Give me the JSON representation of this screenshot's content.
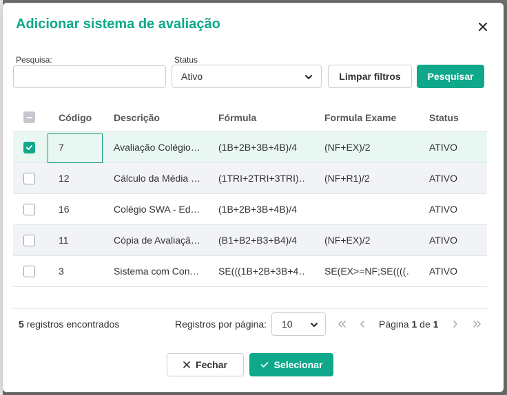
{
  "modal": {
    "title": "Adicionar sistema de avaliação"
  },
  "filters": {
    "search_label": "Pesquisa:",
    "search_value": "",
    "status_label": "Status",
    "status_value": "Ativo",
    "clear_label": "Limpar filtros",
    "search_button_label": "Pesquisar"
  },
  "table": {
    "headers": {
      "code": "Código",
      "description": "Descrição",
      "formula": "Fórmula",
      "exam_formula": "Formula Exame",
      "status": "Status"
    },
    "rows": [
      {
        "code": "7",
        "description": "Avaliação Colégio…",
        "formula": "(1B+2B+3B+4B)/4",
        "exam_formula": "(NF+EX)/2",
        "status": "ATIVO",
        "checked": true
      },
      {
        "code": "12",
        "description": "Cálculo da Média …",
        "formula": "(1TRI+2TRI+3TRI)…",
        "exam_formula": "(NF+R1)/2",
        "status": "ATIVO",
        "checked": false
      },
      {
        "code": "16",
        "description": "Colégio SWA - Ed…",
        "formula": "(1B+2B+3B+4B)/4",
        "exam_formula": "",
        "status": "ATIVO",
        "checked": false
      },
      {
        "code": "11",
        "description": "Cópia de Avaliaçã…",
        "formula": "(B1+B2+B3+B4)/4",
        "exam_formula": "(NF+EX)/2",
        "status": "ATIVO",
        "checked": false
      },
      {
        "code": "3",
        "description": "Sistema com Con…",
        "formula": "SE(((1B+2B+3B+4…",
        "exam_formula": "SE(EX>=NF;SE((((…",
        "status": "ATIVO",
        "checked": false
      }
    ]
  },
  "footer": {
    "count": "5",
    "count_suffix": " registros encontrados",
    "per_page_label": "Registros por página:",
    "per_page_value": "10",
    "page_prefix": "Página ",
    "page_current": "1",
    "page_of": " de ",
    "page_total": "1"
  },
  "actions": {
    "close_label": "Fechar",
    "select_label": "Selecionar"
  },
  "colors": {
    "accent": "#0fa88a",
    "selected_row": "#e9f7f3",
    "alt_row": "#f1f3f6"
  }
}
